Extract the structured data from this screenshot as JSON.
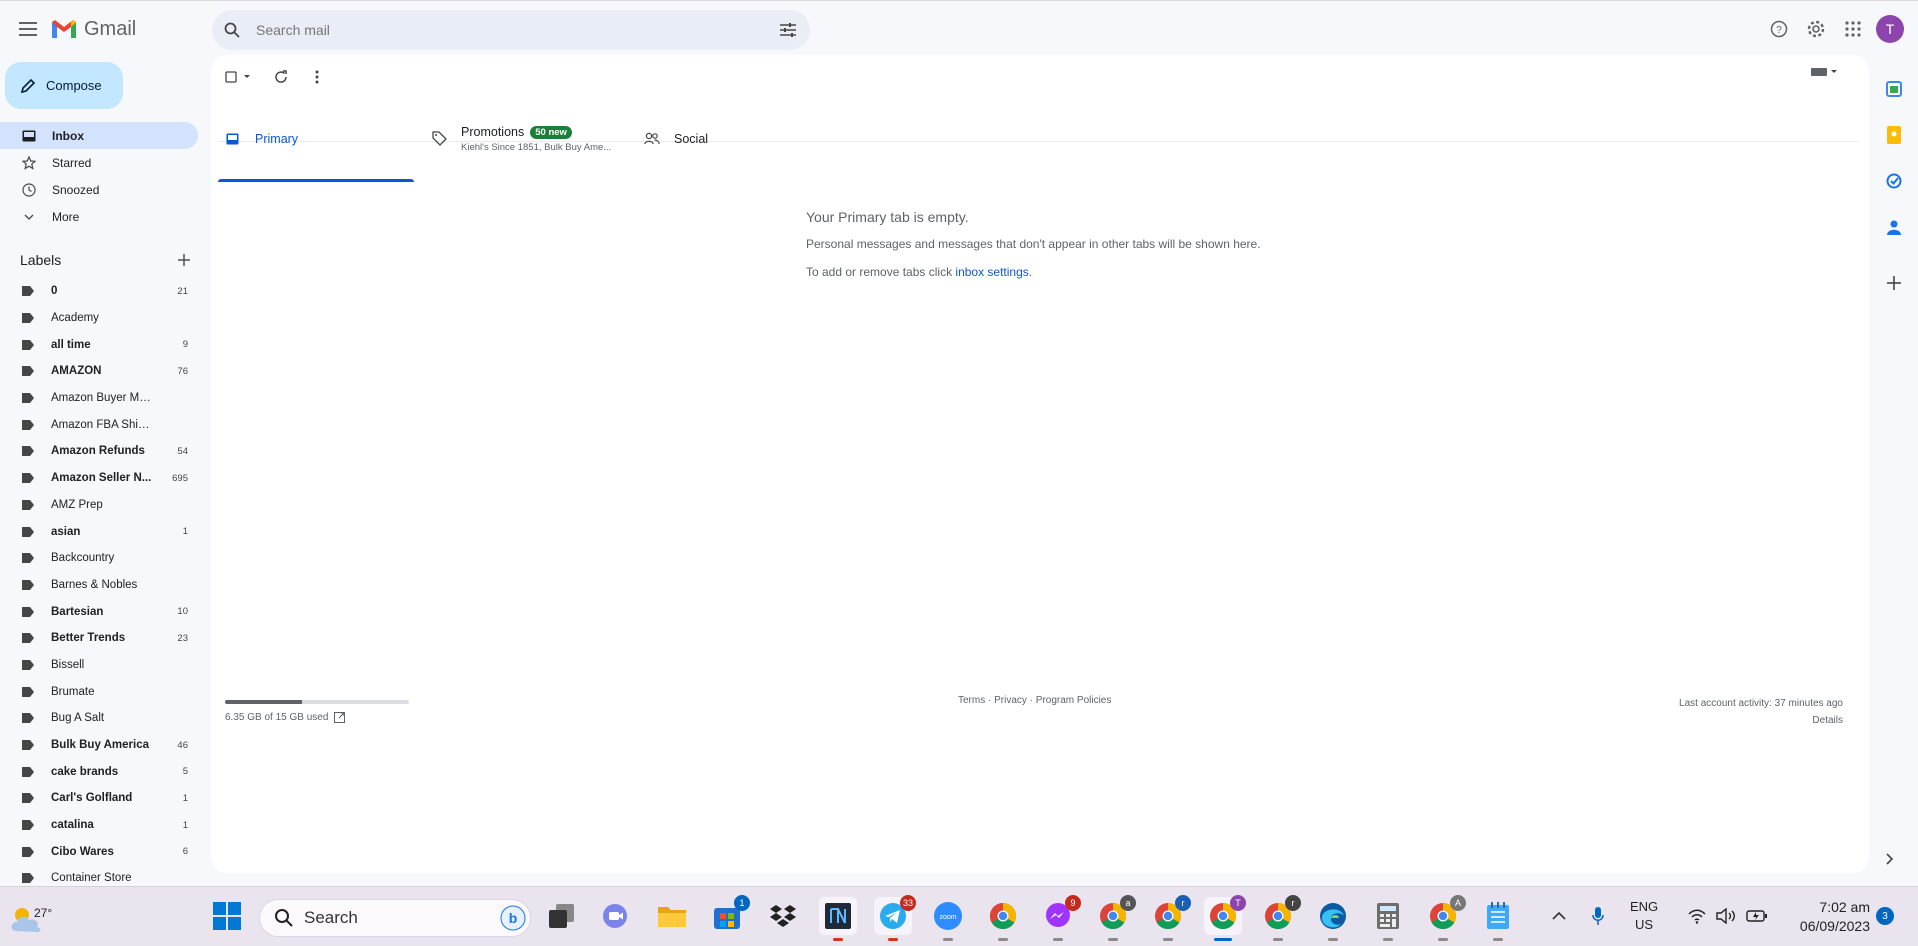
{
  "app": {
    "name": "Gmail"
  },
  "search": {
    "placeholder": "Search mail"
  },
  "user": {
    "avatar_letter": "T",
    "avatar_color": "#8e44ad"
  },
  "compose": {
    "label": "Compose"
  },
  "nav": [
    {
      "label": "Inbox",
      "icon": "inbox-icon",
      "active": true
    },
    {
      "label": "Starred",
      "icon": "star-icon"
    },
    {
      "label": "Snoozed",
      "icon": "clock-icon"
    },
    {
      "label": "More",
      "icon": "chevron-down-icon"
    }
  ],
  "labels_section": {
    "title": "Labels"
  },
  "labels": [
    {
      "name": "0",
      "count": "21",
      "bold": true
    },
    {
      "name": "Academy",
      "count": "",
      "bold": false
    },
    {
      "name": "all time",
      "count": "9",
      "bold": true
    },
    {
      "name": "AMAZON",
      "count": "76",
      "bold": true
    },
    {
      "name": "Amazon Buyer Message",
      "count": "",
      "bold": false
    },
    {
      "name": "Amazon FBA Shipments",
      "count": "",
      "bold": false
    },
    {
      "name": "Amazon Refunds",
      "count": "54",
      "bold": true
    },
    {
      "name": "Amazon Seller N...",
      "count": "695",
      "bold": true
    },
    {
      "name": "AMZ Prep",
      "count": "",
      "bold": false
    },
    {
      "name": "asian",
      "count": "1",
      "bold": true
    },
    {
      "name": "Backcountry",
      "count": "",
      "bold": false
    },
    {
      "name": "Barnes & Nobles",
      "count": "",
      "bold": false
    },
    {
      "name": "Bartesian",
      "count": "10",
      "bold": true
    },
    {
      "name": "Better Trends",
      "count": "23",
      "bold": true
    },
    {
      "name": "Bissell",
      "count": "",
      "bold": false
    },
    {
      "name": "Brumate",
      "count": "",
      "bold": false
    },
    {
      "name": "Bug A Salt",
      "count": "",
      "bold": false
    },
    {
      "name": "Bulk Buy America",
      "count": "46",
      "bold": true
    },
    {
      "name": "cake brands",
      "count": "5",
      "bold": true
    },
    {
      "name": "Carl's Golfland",
      "count": "1",
      "bold": true
    },
    {
      "name": "catalina",
      "count": "1",
      "bold": true
    },
    {
      "name": "Cibo Wares",
      "count": "6",
      "bold": true
    },
    {
      "name": "Container Store",
      "count": "",
      "bold": false
    }
  ],
  "tabs": {
    "primary": {
      "label": "Primary"
    },
    "promotions": {
      "label": "Promotions",
      "badge": "50 new",
      "snippet": "Kiehl's Since 1851, Bulk Buy Ame..."
    },
    "social": {
      "label": "Social"
    }
  },
  "empty_state": {
    "title": "Your Primary tab is empty.",
    "line1": "Personal messages and messages that don't appear in other tabs will be shown here.",
    "line2_prefix": "To add or remove tabs click ",
    "line2_link": "inbox settings",
    "line2_suffix": "."
  },
  "storage": {
    "text": "6.35 GB of 15 GB used",
    "fraction": 0.42
  },
  "footer": {
    "links": "Terms · Privacy · Program Policies",
    "activity": "Last account activity: 37 minutes ago",
    "details": "Details"
  },
  "taskbar": {
    "weather_temp": "27°",
    "search_label": "Search",
    "store_badge": "1",
    "telegram_badge": "33",
    "messenger_badge": "9",
    "chrome_profiles": [
      "a",
      "r",
      "T",
      "r",
      "A"
    ],
    "lang_top": "ENG",
    "lang_bottom": "US",
    "time": "7:02 am",
    "date": "06/09/2023",
    "notifications": "3"
  }
}
